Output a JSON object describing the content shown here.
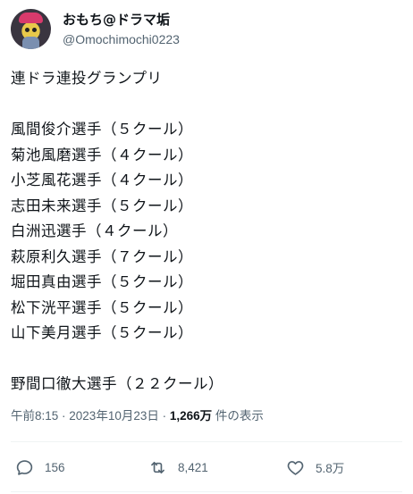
{
  "author": {
    "display_name": "おもち@ドラマ垢",
    "handle": "@Omochimochi0223"
  },
  "tweet": {
    "title_line": "連ドラ連投グランプリ",
    "players": [
      "風間俊介選手（５クール）",
      "菊池風磨選手（４クール）",
      "小芝風花選手（４クール）",
      "志田未来選手（５クール）",
      "白洲迅選手（４クール）",
      "萩原利久選手（７クール）",
      "堀田真由選手（５クール）",
      "松下洸平選手（５クール）",
      "山下美月選手（５クール）"
    ],
    "final_line": "野間口徹大選手（２２クール）"
  },
  "meta": {
    "time": "午前8:15",
    "sep1": " · ",
    "date": "2023年10月23日",
    "sep2": " · ",
    "views": "1,266万",
    "views_suffix": " 件の表示"
  },
  "actions": {
    "reply_icon": "reply-icon",
    "reply_count": "156",
    "retweet_icon": "retweet-icon",
    "retweet_count": "8,421",
    "like_icon": "heart-icon",
    "like_count": "5.8万"
  },
  "colors": {
    "text": "#0f1419",
    "secondary": "#536471",
    "divider": "#eff3f4"
  }
}
